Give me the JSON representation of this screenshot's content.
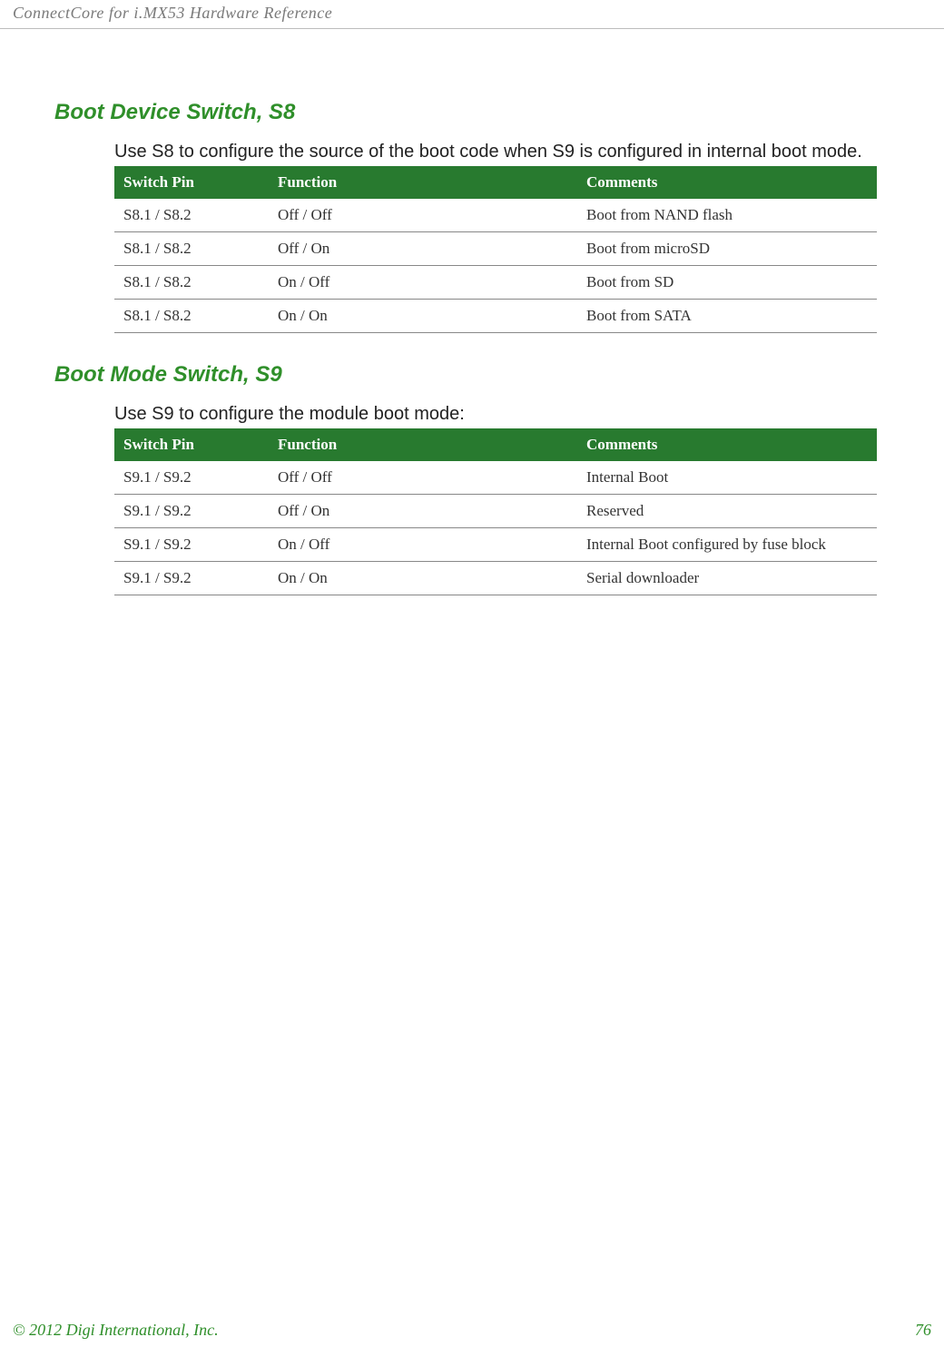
{
  "header": {
    "title": "ConnectCore for i.MX53 Hardware Reference"
  },
  "section1": {
    "title": "Boot Device Switch, S8",
    "intro": "Use S8 to configure the source of the boot code when S9 is configured in internal boot mode.",
    "table": {
      "headers": {
        "col1": "Switch Pin",
        "col2": "Function",
        "col3": "Comments"
      },
      "rows": [
        {
          "pin": "S8.1 / S8.2",
          "func": "Off / Off",
          "comment": "Boot from NAND flash"
        },
        {
          "pin": "S8.1 / S8.2",
          "func": "Off / On",
          "comment": "Boot from microSD"
        },
        {
          "pin": "S8.1 / S8.2",
          "func": "On / Off",
          "comment": "Boot from SD"
        },
        {
          "pin": "S8.1 / S8.2",
          "func": "On / On",
          "comment": "Boot from SATA"
        }
      ]
    }
  },
  "section2": {
    "title": "Boot Mode Switch, S9",
    "intro": "Use S9 to configure the module boot mode:",
    "table": {
      "headers": {
        "col1": "Switch Pin",
        "col2": "Function",
        "col3": "Comments"
      },
      "rows": [
        {
          "pin": "S9.1 / S9.2",
          "func": "Off / Off",
          "comment": "Internal Boot"
        },
        {
          "pin": "S9.1 / S9.2",
          "func": "Off / On",
          "comment": "Reserved"
        },
        {
          "pin": "S9.1 / S9.2",
          "func": "On / Off",
          "comment": "Internal Boot configured by fuse block"
        },
        {
          "pin": "S9.1 / S9.2",
          "func": "On / On",
          "comment": "Serial downloader"
        }
      ]
    }
  },
  "footer": {
    "copyright": "© 2012 Digi International, Inc.",
    "page": "76"
  }
}
